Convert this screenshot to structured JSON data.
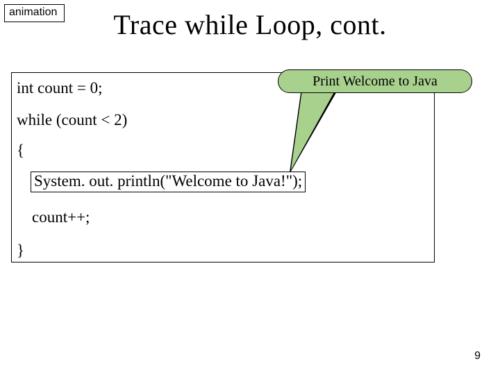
{
  "animation_label": "animation",
  "title": "Trace while Loop, cont.",
  "callout_text": "Print Welcome to Java",
  "code": {
    "l1": "int count = 0;",
    "l2": "while (count < 2)",
    "l3": "{",
    "l4": "System. out. println(\"Welcome to Java!\");",
    "l5": "count++;",
    "l6": "}"
  },
  "page_number": "9"
}
